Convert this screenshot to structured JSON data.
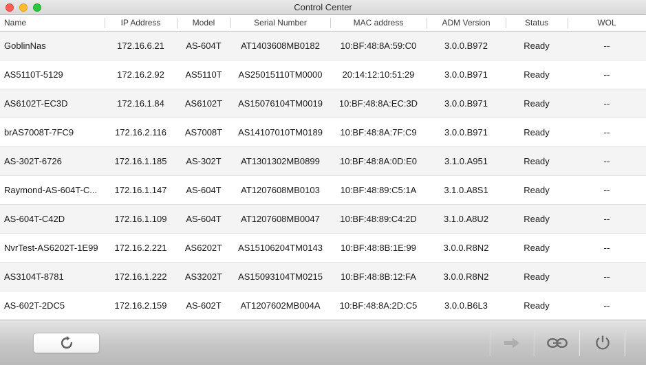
{
  "window": {
    "title": "Control Center",
    "traffic_lights": [
      {
        "name": "close",
        "color": "#ff5f57"
      },
      {
        "name": "minimize",
        "color": "#ffbd2e"
      },
      {
        "name": "maximize",
        "color": "#28c940"
      }
    ]
  },
  "table": {
    "columns": [
      {
        "key": "name",
        "label": "Name"
      },
      {
        "key": "ip",
        "label": "IP Address"
      },
      {
        "key": "model",
        "label": "Model"
      },
      {
        "key": "serial",
        "label": "Serial Number"
      },
      {
        "key": "mac",
        "label": "MAC address"
      },
      {
        "key": "adm",
        "label": "ADM Version"
      },
      {
        "key": "status",
        "label": "Status"
      },
      {
        "key": "wol",
        "label": "WOL"
      }
    ],
    "rows": [
      {
        "name": "GoblinNas",
        "ip": "172.16.6.21",
        "model": "AS-604T",
        "serial": "AT1403608MB0182",
        "mac": "10:BF:48:8A:59:C0",
        "adm": "3.0.0.B972",
        "status": "Ready",
        "wol": "--"
      },
      {
        "name": "AS5110T-5129",
        "ip": "172.16.2.92",
        "model": "AS5110T",
        "serial": "AS25015110TM0000",
        "mac": "20:14:12:10:51:29",
        "adm": "3.0.0.B971",
        "status": "Ready",
        "wol": "--"
      },
      {
        "name": "AS6102T-EC3D",
        "ip": "172.16.1.84",
        "model": "AS6102T",
        "serial": "AS15076104TM0019",
        "mac": "10:BF:48:8A:EC:3D",
        "adm": "3.0.0.B971",
        "status": "Ready",
        "wol": "--"
      },
      {
        "name": "brAS7008T-7FC9",
        "ip": "172.16.2.116",
        "model": "AS7008T",
        "serial": "AS14107010TM0189",
        "mac": "10:BF:48:8A:7F:C9",
        "adm": "3.0.0.B971",
        "status": "Ready",
        "wol": "--"
      },
      {
        "name": "AS-302T-6726",
        "ip": "172.16.1.185",
        "model": "AS-302T",
        "serial": "AT1301302MB0899",
        "mac": "10:BF:48:8A:0D:E0",
        "adm": "3.1.0.A951",
        "status": "Ready",
        "wol": "--"
      },
      {
        "name": "Raymond-AS-604T-C...",
        "ip": "172.16.1.147",
        "model": "AS-604T",
        "serial": "AT1207608MB0103",
        "mac": "10:BF:48:89:C5:1A",
        "adm": "3.1.0.A8S1",
        "status": "Ready",
        "wol": "--"
      },
      {
        "name": "AS-604T-C42D",
        "ip": "172.16.1.109",
        "model": "AS-604T",
        "serial": "AT1207608MB0047",
        "mac": "10:BF:48:89:C4:2D",
        "adm": "3.1.0.A8U2",
        "status": "Ready",
        "wol": "--"
      },
      {
        "name": "NvrTest-AS6202T-1E99",
        "ip": "172.16.2.221",
        "model": "AS6202T",
        "serial": "AS15106204TM0143",
        "mac": "10:BF:48:8B:1E:99",
        "adm": "3.0.0.R8N2",
        "status": "Ready",
        "wol": "--"
      },
      {
        "name": "AS3104T-8781",
        "ip": "172.16.1.222",
        "model": "AS3202T",
        "serial": "AS15093104TM0215",
        "mac": "10:BF:48:8B:12:FA",
        "adm": "3.0.0.R8N2",
        "status": "Ready",
        "wol": "--"
      },
      {
        "name": "AS-602T-2DC5",
        "ip": "172.16.2.159",
        "model": "AS-602T",
        "serial": "AT1207602MB004A",
        "mac": "10:BF:48:8A:2D:C5",
        "adm": "3.0.0.B6L3",
        "status": "Ready",
        "wol": "--"
      }
    ]
  },
  "toolbar": {
    "refresh": {
      "icon": "refresh-icon"
    },
    "actions": [
      {
        "name": "connect-arrow-icon",
        "icon": "arrow-right-icon",
        "enabled": false
      },
      {
        "name": "link-icon",
        "icon": "chain-link-icon",
        "enabled": true
      },
      {
        "name": "power-icon",
        "icon": "power-icon",
        "enabled": true
      }
    ]
  }
}
